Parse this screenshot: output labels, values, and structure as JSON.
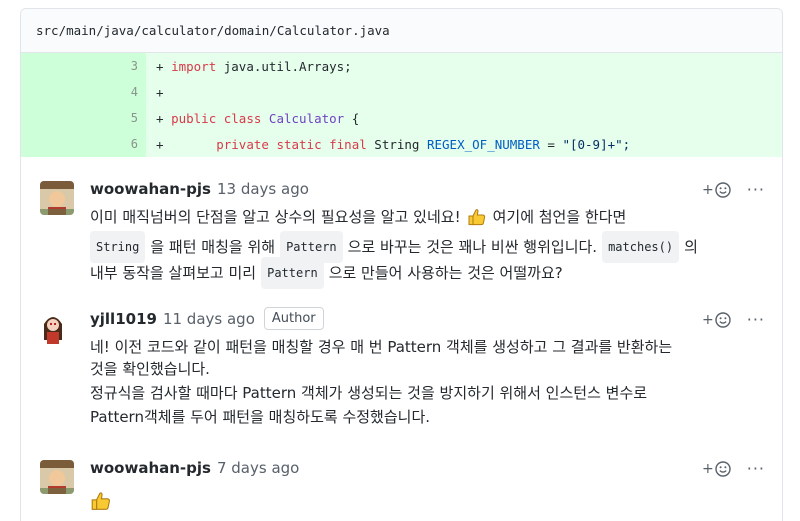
{
  "file_path": "src/main/java/calculator/domain/Calculator.java",
  "code_lines": [
    {
      "num": "3",
      "plus": "+",
      "kw": "import",
      "rest": " java.util.Arrays;"
    },
    {
      "num": "4",
      "plus": "+"
    },
    {
      "num": "5",
      "plus": "+",
      "kw1": "public",
      "kw2": "class",
      "type": "Calculator",
      "brace": " {"
    },
    {
      "num": "6",
      "plus": "+",
      "m1": "private",
      "m2": "static",
      "m3": "final",
      "t": "String",
      "name": "REGEX_OF_NUMBER",
      "eq": " = ",
      "val": "\"[0-9]+\";"
    }
  ],
  "comments": [
    {
      "author": "woowahan-pjs",
      "time": "13 days ago",
      "line1_a": "이미 매직넘버의 단점을 알고 상수의 필요성을 알고 있네요!",
      "line1_b": "여기에 첨언을 한다면",
      "line2_code1": "String",
      "line2_a": "을 패턴 매칭을 위해",
      "line2_code2": "Pattern",
      "line2_b": "으로 바꾸는 것은 꽤나 비싼 행위입니다.",
      "line2_code3": "matches()",
      "line2_c": "의",
      "line3_a": "내부 동작을 살펴보고 미리",
      "line3_code": "Pattern",
      "line3_b": "으로 만들어 사용하는 것은 어떨까요?"
    },
    {
      "author": "yjll1019",
      "time": "11 days ago",
      "badge": "Author",
      "lines": [
        "네! 이전 코드와 같이 패턴을 매칭할 경우 매 번 Pattern 객체를 생성하고 그 결과를 반환하는",
        "것을 확인했습니다.",
        "정규식을 검사할 때마다 Pattern 객체가 생성되는 것을 방지하기 위해서 인스턴스 변수로",
        "Pattern객체를 두어 패턴을 매칭하도록 수정했습니다."
      ]
    },
    {
      "author": "woowahan-pjs",
      "time": "7 days ago"
    }
  ],
  "actions": {
    "react_label": "+",
    "more_label": "···"
  },
  "icons": {
    "reaction": "smiley-icon",
    "thumbs": "thumbs-up-icon",
    "more": "kebab-icon"
  }
}
